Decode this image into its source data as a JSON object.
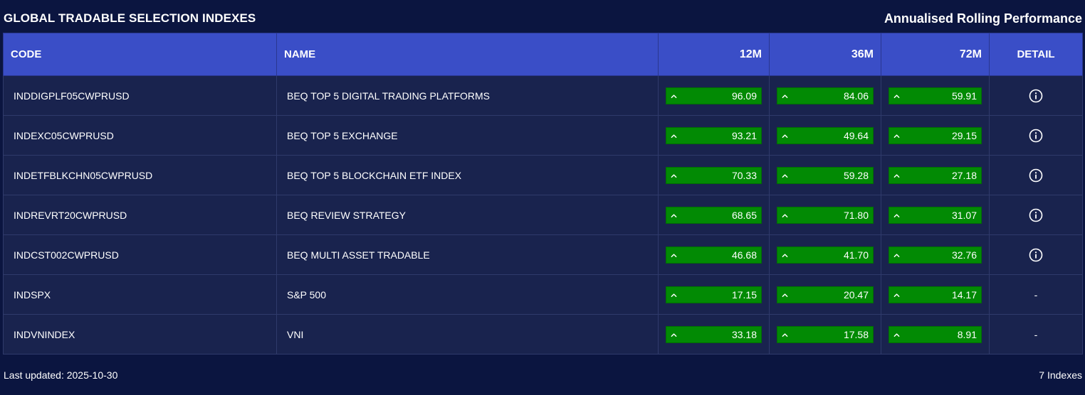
{
  "header": {
    "title": "GLOBAL TRADABLE SELECTION INDEXES",
    "subtitle": "Annualised Rolling Performance"
  },
  "table": {
    "columns": {
      "code": "CODE",
      "name": "NAME",
      "m12": "12M",
      "m36": "36M",
      "m72": "72M",
      "detail": "DETAIL"
    },
    "rows": [
      {
        "code": "INDDIGPLF05CWPRUSD",
        "name": "BEQ TOP 5 DIGITAL TRADING PLATFORMS",
        "m12": "96.09",
        "m36": "84.06",
        "m72": "59.91",
        "detail": "info-icon"
      },
      {
        "code": "INDEXC05CWPRUSD",
        "name": "BEQ TOP 5 EXCHANGE",
        "m12": "93.21",
        "m36": "49.64",
        "m72": "29.15",
        "detail": "info-icon"
      },
      {
        "code": "INDETFBLKCHN05CWPRUSD",
        "name": "BEQ TOP 5 BLOCKCHAIN ETF INDEX",
        "m12": "70.33",
        "m36": "59.28",
        "m72": "27.18",
        "detail": "info-icon"
      },
      {
        "code": "INDREVRT20CWPRUSD",
        "name": "BEQ REVIEW STRATEGY",
        "m12": "68.65",
        "m36": "71.80",
        "m72": "31.07",
        "detail": "info-icon"
      },
      {
        "code": "INDCST002CWPRUSD",
        "name": "BEQ MULTI ASSET TRADABLE",
        "m12": "46.68",
        "m36": "41.70",
        "m72": "32.76",
        "detail": "info-icon"
      },
      {
        "code": "INDSPX",
        "name": "S&P 500",
        "m12": "17.15",
        "m36": "20.47",
        "m72": "14.17",
        "detail": "-"
      },
      {
        "code": "INDVNINDEX",
        "name": "VNI",
        "m12": "33.18",
        "m36": "17.58",
        "m72": "8.91",
        "detail": "-"
      }
    ]
  },
  "footer": {
    "last_updated": "Last updated: 2025-10-30",
    "count": "7 Indexes"
  },
  "colors": {
    "background": "#0b1540",
    "header_row": "#3a4ec7",
    "row": "#19234e",
    "positive": "#028a04"
  },
  "icons": {
    "up": "chevron-up-icon",
    "detail": "info-icon"
  }
}
